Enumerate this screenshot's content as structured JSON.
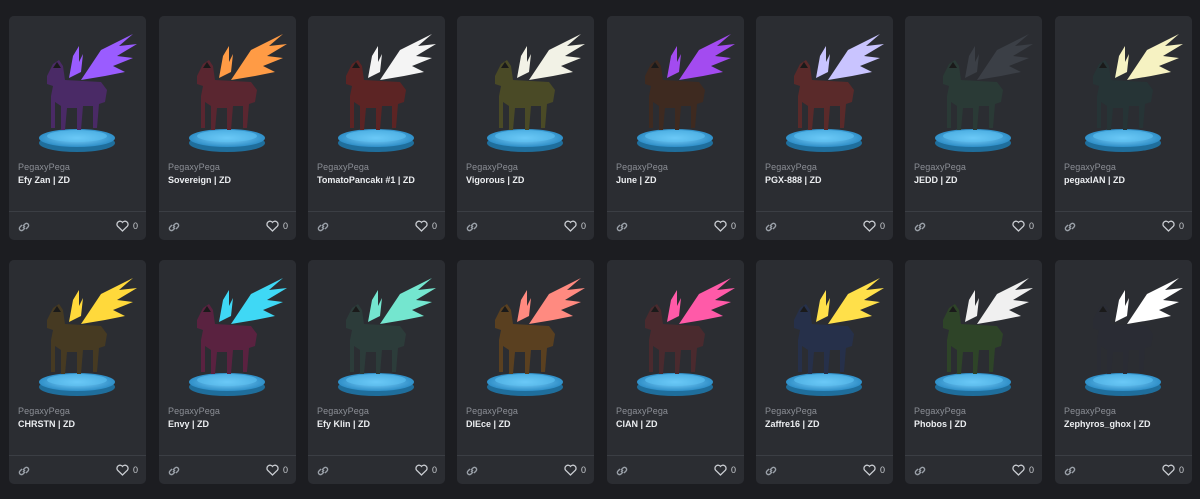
{
  "icons": {
    "link": "link-icon",
    "like": "heart-icon"
  },
  "cards": [
    {
      "collection": "PegaxyPega",
      "name": "Efy Zan | ZD",
      "likes": "0",
      "wing": "#9a5cff",
      "body": "#4a2a66"
    },
    {
      "collection": "PegaxyPega",
      "name": "Sovereign | ZD",
      "likes": "0",
      "wing": "#ff9b45",
      "body": "#5a2630"
    },
    {
      "collection": "PegaxyPega",
      "name": "TomatoPancakı #1 | ZD",
      "likes": "0",
      "wing": "#f4f4f4",
      "body": "#5c2424"
    },
    {
      "collection": "PegaxyPega",
      "name": "Vigorous | ZD",
      "likes": "0",
      "wing": "#f2f2e6",
      "body": "#4a4a26"
    },
    {
      "collection": "PegaxyPega",
      "name": "June | ZD",
      "likes": "0",
      "wing": "#a34bf0",
      "body": "#3e2a20"
    },
    {
      "collection": "PegaxyPega",
      "name": "PGX-888 | ZD",
      "likes": "0",
      "wing": "#c9c4ff",
      "body": "#5a2a2a"
    },
    {
      "collection": "PegaxyPega",
      "name": "JEDD | ZD",
      "likes": "0",
      "wing": "#3b3f46",
      "body": "#2a3a36"
    },
    {
      "collection": "PegaxyPega",
      "name": "pegaxIAN | ZD",
      "likes": "0",
      "wing": "#f6f2c2",
      "body": "#263436"
    },
    {
      "collection": "PegaxyPega",
      "name": "CHRSTN | ZD",
      "likes": "0",
      "wing": "#ffd93b",
      "body": "#463a22"
    },
    {
      "collection": "PegaxyPega",
      "name": "Envy | ZD",
      "likes": "0",
      "wing": "#3fd8f5",
      "body": "#5a2240"
    },
    {
      "collection": "PegaxyPega",
      "name": "Efy Klin | ZD",
      "likes": "0",
      "wing": "#74e6cf",
      "body": "#2c3c3a"
    },
    {
      "collection": "PegaxyPega",
      "name": "DIEce | ZD",
      "likes": "0",
      "wing": "#ff8a80",
      "body": "#5a4020"
    },
    {
      "collection": "PegaxyPega",
      "name": "CIAN | ZD",
      "likes": "0",
      "wing": "#ff5aa8",
      "body": "#4a2a2e"
    },
    {
      "collection": "PegaxyPega",
      "name": "Zaffre16 | ZD",
      "likes": "0",
      "wing": "#ffe04a",
      "body": "#26304a"
    },
    {
      "collection": "PegaxyPega",
      "name": "Phobos | ZD",
      "likes": "0",
      "wing": "#f0f0f0",
      "body": "#2e4428"
    },
    {
      "collection": "PegaxyPega",
      "name": "Zephyros_ghox | ZD",
      "likes": "0",
      "wing": "#ffffff",
      "body": "#2a2c34"
    }
  ]
}
